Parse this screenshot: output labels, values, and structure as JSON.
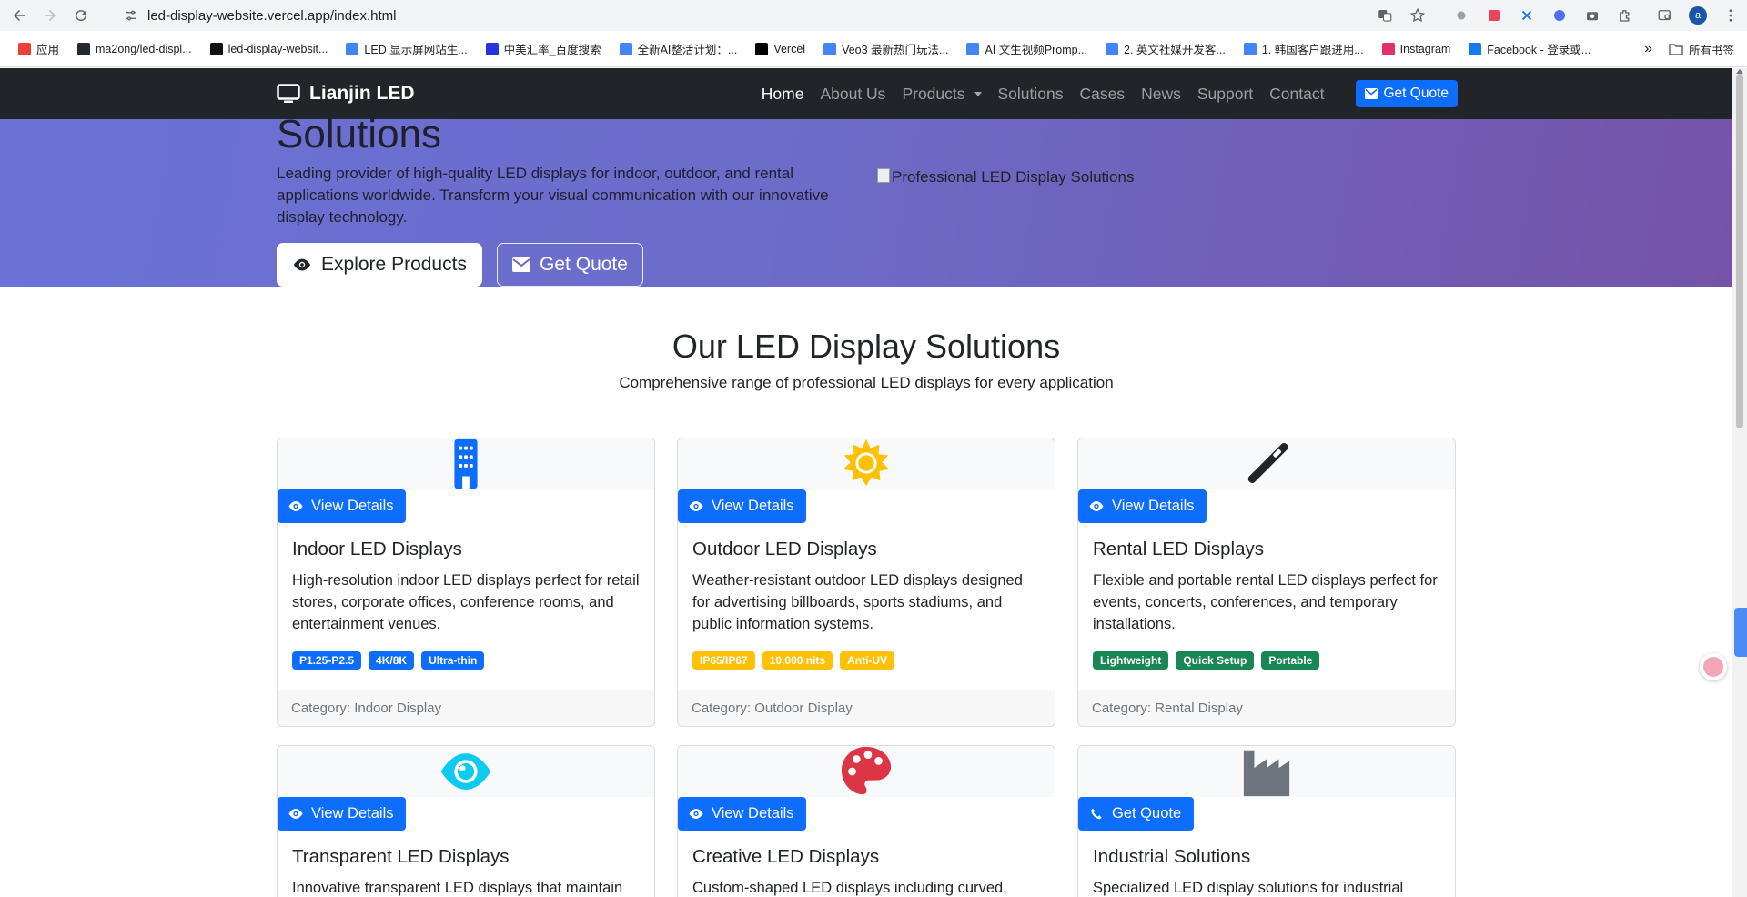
{
  "browser": {
    "url": "led-display-website.vercel.app/index.html",
    "avatar_letter": "a",
    "bookmarks": [
      {
        "label": "应用",
        "color": "#ea4335"
      },
      {
        "label": "ma2ong/led-displ...",
        "color": "#24292f"
      },
      {
        "label": "led-display-websit...",
        "color": "#111111"
      },
      {
        "label": "LED 显示屏网站生...",
        "color": "#4285f4"
      },
      {
        "label": "中美汇率_百度搜索",
        "color": "#2932e1"
      },
      {
        "label": "全新AI整活计划：...",
        "color": "#4285f4"
      },
      {
        "label": "Vercel",
        "color": "#000000"
      },
      {
        "label": "Veo3 最新热门玩法...",
        "color": "#4285f4"
      },
      {
        "label": "AI 文生视频Promp...",
        "color": "#4285f4"
      },
      {
        "label": "2. 英文社媒开发客...",
        "color": "#4285f4"
      },
      {
        "label": "1. 韩国客户跟进用...",
        "color": "#4285f4"
      },
      {
        "label": "Instagram",
        "color": "#e1306c"
      },
      {
        "label": "Facebook - 登录或...",
        "color": "#1877f2"
      }
    ],
    "more_label": "»",
    "all_bookmarks": "所有书签"
  },
  "navbar": {
    "brand": "Lianjin LED",
    "links": [
      {
        "label": "Home",
        "active": true
      },
      {
        "label": "About Us"
      },
      {
        "label": "Products"
      },
      {
        "label": "Solutions"
      },
      {
        "label": "Cases"
      },
      {
        "label": "News"
      },
      {
        "label": "Support"
      },
      {
        "label": "Contact"
      }
    ],
    "cta": "Get Quote"
  },
  "hero": {
    "title": "Solutions",
    "description": "Leading provider of high-quality LED displays for indoor, outdoor, and rental applications worldwide. Transform your visual communication with our innovative display technology.",
    "explore_label": "Explore Products",
    "quote_label": "Get Quote",
    "image_alt": "Professional LED Display Solutions"
  },
  "section": {
    "title": "Our LED Display Solutions",
    "subtitle": "Comprehensive range of professional LED displays for every application"
  },
  "cards": [
    {
      "icon": "building-icon",
      "icon_color": "#0d6efd",
      "button": "View Details",
      "title": "Indoor LED Displays",
      "text": "High-resolution indoor LED displays perfect for retail stores, corporate offices, conference rooms, and entertainment venues.",
      "tags": [
        "P1.25-P2.5",
        "4K/8K",
        "Ultra-thin"
      ],
      "tag_style": "blue",
      "footer": "Category: Indoor Display"
    },
    {
      "icon": "sun-icon",
      "icon_color": "#ffc107",
      "button": "View Details",
      "title": "Outdoor LED Displays",
      "text": "Weather-resistant outdoor LED displays designed for advertising billboards, sports stadiums, and public information systems.",
      "tags": [
        "IP65/IP67",
        "10,000 nits",
        "Anti-UV"
      ],
      "tag_style": "yellow",
      "footer": "Category: Outdoor Display"
    },
    {
      "icon": "tools-icon",
      "icon_color": "#212529",
      "button": "View Details",
      "title": "Rental LED Displays",
      "text": "Flexible and portable rental LED displays perfect for events, concerts, conferences, and temporary installations.",
      "tags": [
        "Lightweight",
        "Quick Setup",
        "Portable"
      ],
      "tag_style": "green",
      "footer": "Category: Rental Display"
    },
    {
      "icon": "eye-icon",
      "icon_color": "#0dcaf0",
      "button": "View Details",
      "title": "Transparent LED Displays",
      "text": "Innovative transparent LED displays that maintain"
    },
    {
      "icon": "palette-icon",
      "icon_color": "#dc3545",
      "button": "View Details",
      "title": "Creative LED Displays",
      "text": "Custom-shaped LED displays including curved,"
    },
    {
      "icon": "factory-icon",
      "icon_color": "#6c757d",
      "button": "Get Quote",
      "title": "Industrial Solutions",
      "text": "Specialized LED display solutions for industrial"
    }
  ]
}
